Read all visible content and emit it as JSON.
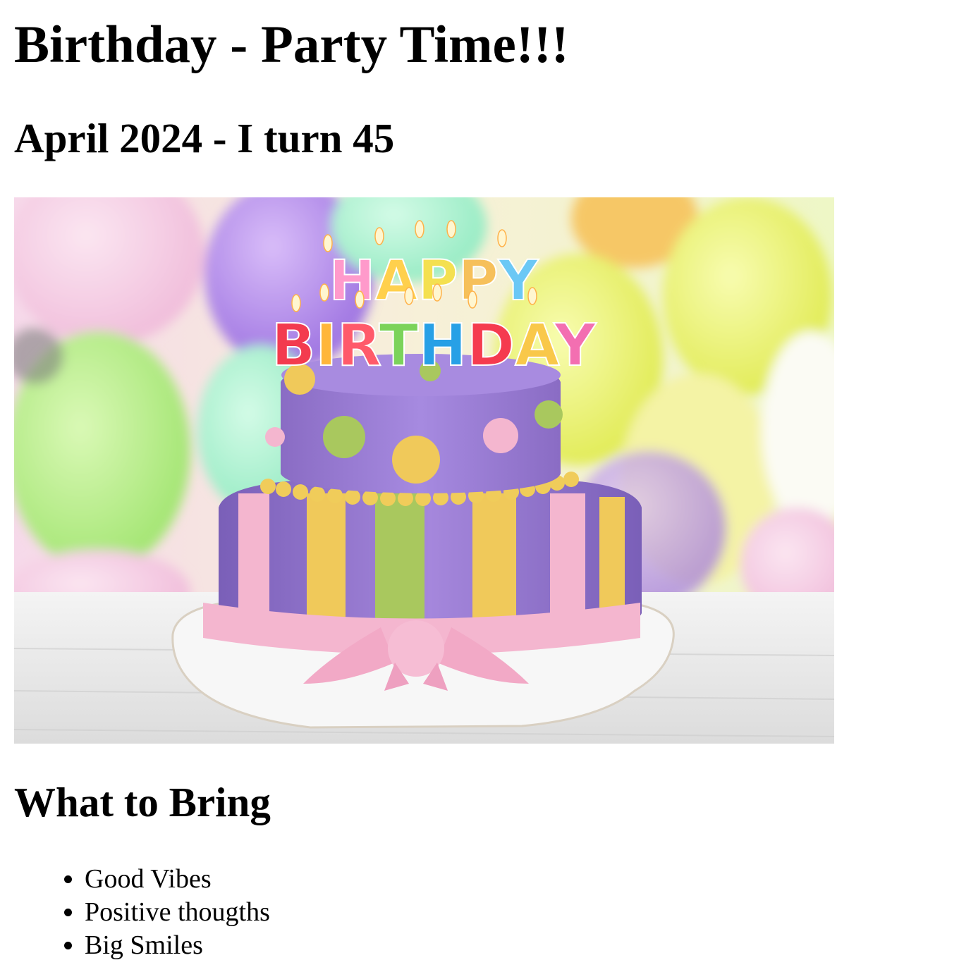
{
  "page": {
    "title": "Birthday - Party Time!!!",
    "subtitle": "April 2024 - I turn 45",
    "section_title": "What to Bring"
  },
  "hero_image": {
    "candle_text_top": "HAPPY",
    "candle_text_bottom": "BIRTHDAY",
    "colors": {
      "cake_purple": "#9a7fd0",
      "ribbon_pink": "#f4b6cf",
      "stripe_yellow": "#f0c95a",
      "stripe_green": "#a9c85e",
      "balloon_yellow": "#e9f26a",
      "balloon_green": "#b6ef88",
      "balloon_purple": "#b98ef0",
      "table_white": "#eeeeee"
    }
  },
  "bring_list": {
    "items": [
      "Good Vibes",
      "Positive thougths",
      "Big Smiles"
    ]
  }
}
